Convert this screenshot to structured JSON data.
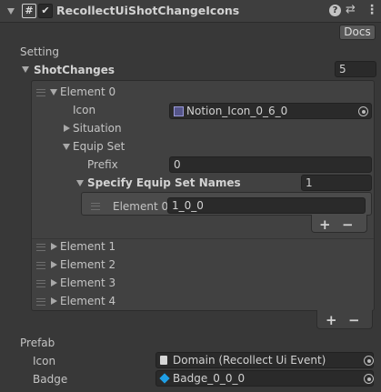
{
  "header": {
    "title": "RecollectUiShotChangeIcons",
    "hash_glyph": "#",
    "check_glyph": "✔",
    "help_glyph": "?",
    "settings_glyph": "⇄",
    "more_glyph": "⋮"
  },
  "docs_button": "Docs",
  "setting_section": "Setting",
  "shot_changes": {
    "label": "ShotChanges",
    "count": "5",
    "elements": [
      {
        "label": "Element 0",
        "icon_label": "Icon",
        "icon_value": "Notion_Icon_0_6_0",
        "situation_label": "Situation",
        "equip_set_label": "Equip Set",
        "prefix_label": "Prefix",
        "prefix_value": "0",
        "specify_label": "Specify Equip Set Names",
        "specify_count": "1",
        "names": [
          {
            "label": "Element 0",
            "value": "1_0_0"
          }
        ]
      },
      {
        "label": "Element 1"
      },
      {
        "label": "Element 2"
      },
      {
        "label": "Element 3"
      },
      {
        "label": "Element 4"
      }
    ]
  },
  "list_buttons": {
    "add": "+",
    "remove": "−"
  },
  "prefab": {
    "section": "Prefab",
    "icon_label": "Icon",
    "icon_value": "Domain (Recollect Ui Event)",
    "badge_label": "Badge",
    "badge_value": "Badge_0_0_0"
  },
  "colors": {
    "background": "#383838",
    "header": "#3e3e3e",
    "list_panel": "#414141",
    "nested_panel": "#4b4b4b",
    "field": "#2a2a2a",
    "badge_icon": "#1f9fe6"
  }
}
